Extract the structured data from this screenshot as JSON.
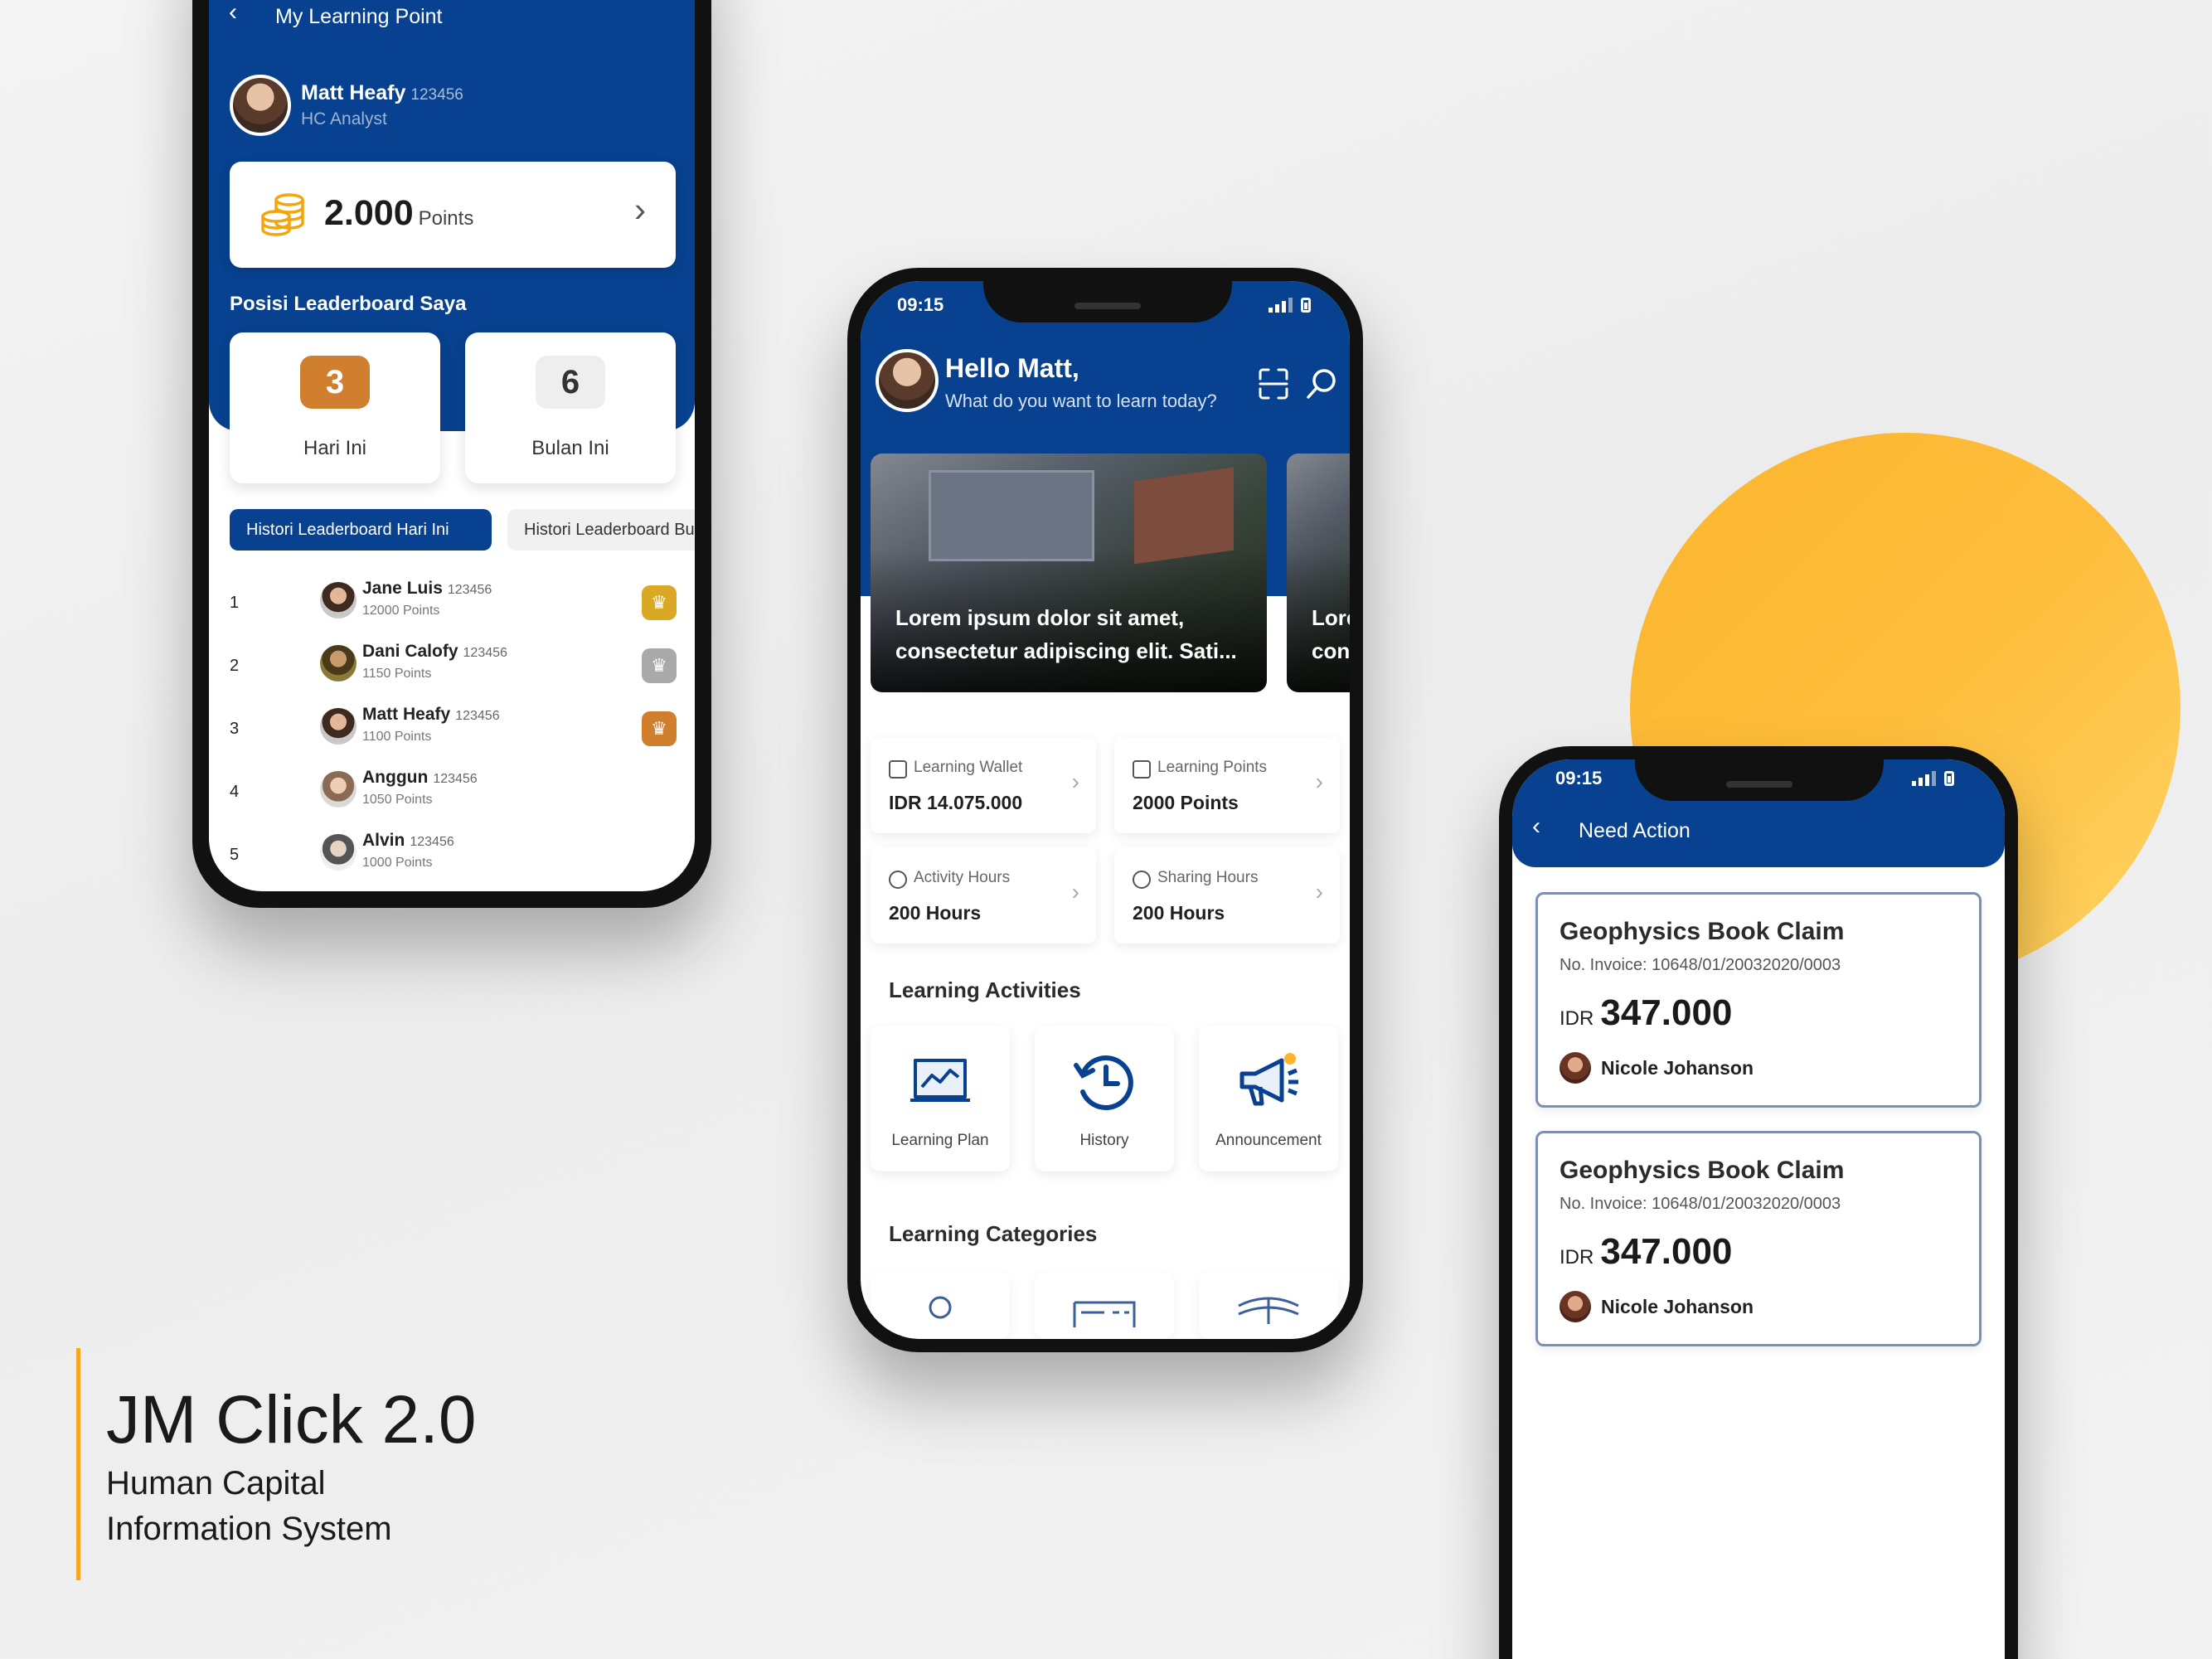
{
  "caption": {
    "title": "JM Click 2.0",
    "subtitle_line1": "Human Capital",
    "subtitle_line2": "Information System"
  },
  "colors": {
    "primary": "#07418f",
    "accent": "#fbb52e",
    "gold": "#d9a925",
    "silver": "#a9a9a9",
    "bronze": "#cf7f2e"
  },
  "phone1": {
    "header_title": "My Learning Point",
    "user": {
      "name": "Matt Heafy",
      "id": "123456",
      "role": "HC Analyst"
    },
    "points": {
      "value": "2.000",
      "label": "Points"
    },
    "leaderboard_title": "Posisi Leaderboard Saya",
    "ranks": [
      {
        "value": "3",
        "label": "Hari Ini"
      },
      {
        "value": "6",
        "label": "Bulan Ini"
      }
    ],
    "tabs": [
      "Histori Leaderboard Hari Ini",
      "Histori Leaderboard Bulan Ini"
    ],
    "rows": [
      {
        "rank": "1",
        "name": "Jane Luis",
        "id": "123456",
        "points": "12000 Points"
      },
      {
        "rank": "2",
        "name": "Dani Calofy",
        "id": "123456",
        "points": "1150 Points"
      },
      {
        "rank": "3",
        "name": "Matt Heafy",
        "id": "123456",
        "points": "1100 Points"
      },
      {
        "rank": "4",
        "name": "Anggun",
        "id": "123456",
        "points": "1050 Points"
      },
      {
        "rank": "5",
        "name": "Alvin",
        "id": "123456",
        "points": "1000 Points"
      }
    ]
  },
  "phone2": {
    "time": "09:15",
    "greeting": "Hello Matt,",
    "subtitle": "What do you want to learn today?",
    "banners": [
      {
        "text": "Lorem ipsum dolor sit amet, consectetur adipiscing elit. Sati..."
      },
      {
        "text": "Lore con"
      }
    ],
    "stats": [
      {
        "label": "Learning Wallet",
        "value": "IDR 14.075.000",
        "icon": "wallet-icon"
      },
      {
        "label": "Learning Points",
        "value": "2000 Points",
        "icon": "coins-icon"
      },
      {
        "label": "Activity Hours",
        "value": "200 Hours",
        "icon": "clock-icon"
      },
      {
        "label": "Sharing Hours",
        "value": "200 Hours",
        "icon": "clock-icon"
      }
    ],
    "activities_title": "Learning Activities",
    "activities": [
      {
        "label": "Learning Plan",
        "icon": "chart-board-icon"
      },
      {
        "label": "History",
        "icon": "history-icon"
      },
      {
        "label": "Announcement",
        "icon": "megaphone-icon"
      }
    ],
    "categories_title": "Learning Categories"
  },
  "phone3": {
    "time": "09:15",
    "header_title": "Need Action",
    "claims": [
      {
        "title": "Geophysics Book Claim",
        "invoice": "No. Invoice: 10648/01/20032020/0003",
        "currency": "IDR",
        "amount": "347.000",
        "person": "Nicole Johanson"
      },
      {
        "title": "Geophysics Book Claim",
        "invoice": "No. Invoice: 10648/01/20032020/0003",
        "currency": "IDR",
        "amount": "347.000",
        "person": "Nicole Johanson"
      }
    ]
  }
}
